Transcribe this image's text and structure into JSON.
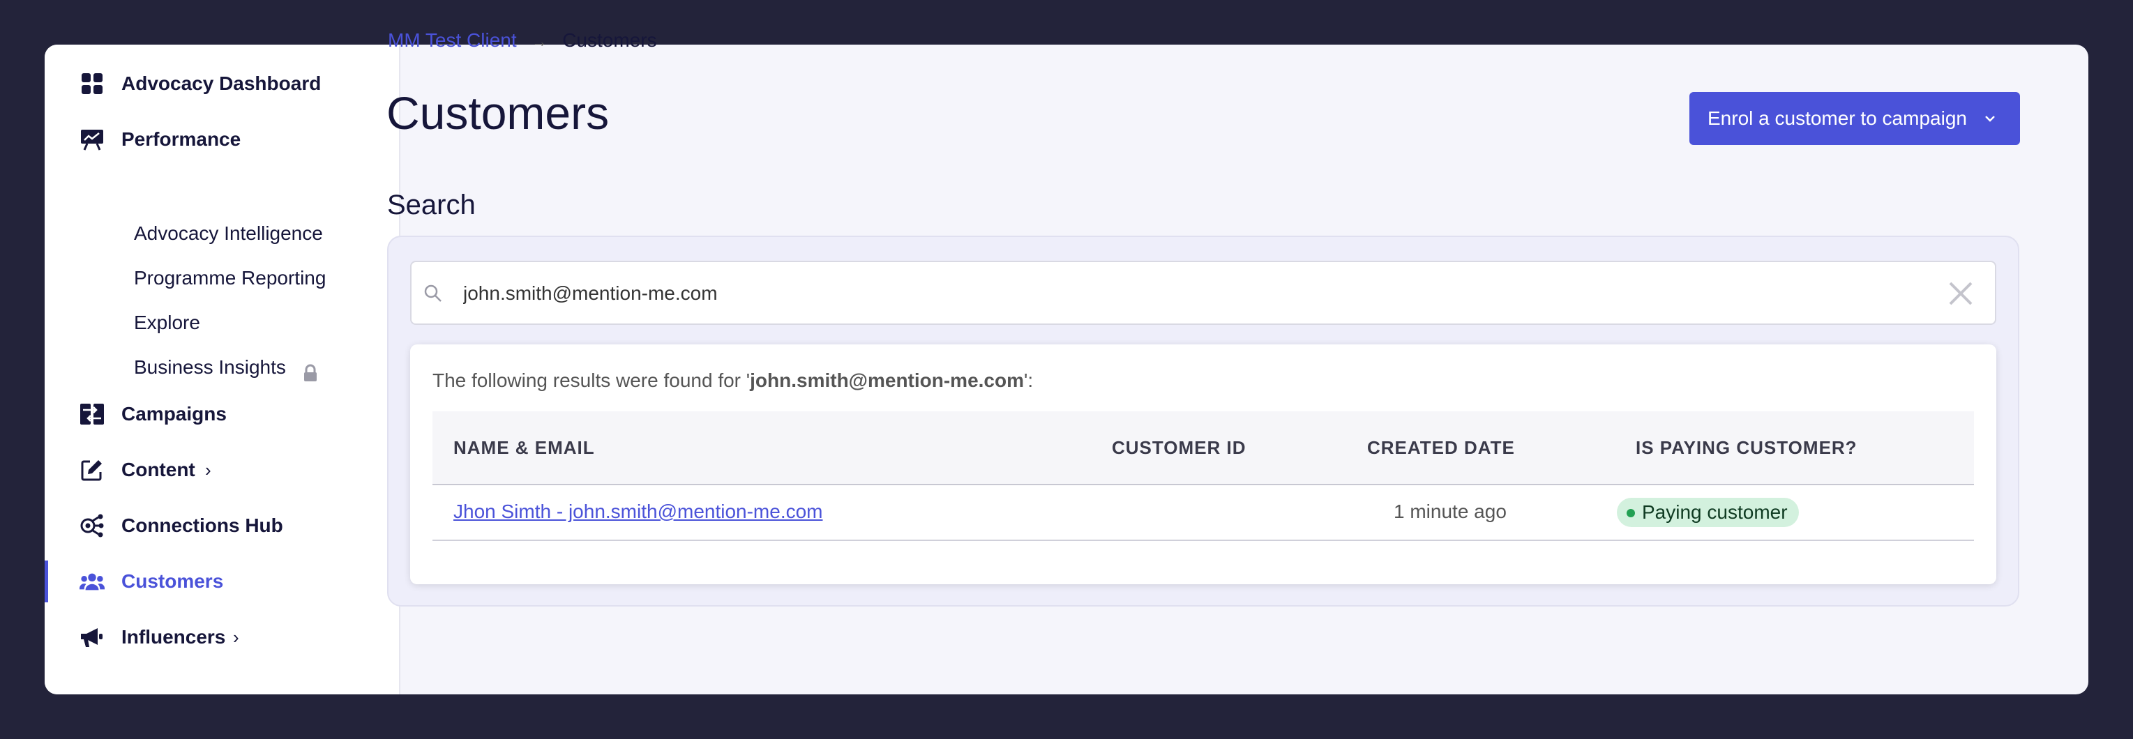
{
  "sidebar": {
    "items": [
      {
        "label": "Advocacy Dashboard",
        "icon": "grid-icon"
      },
      {
        "label": "Performance",
        "icon": "presentation-chart-icon"
      },
      {
        "label": "Campaigns",
        "icon": "exchange-icon"
      },
      {
        "label": "Content",
        "icon": "edit-icon"
      },
      {
        "label": "Connections Hub",
        "icon": "hub-icon"
      },
      {
        "label": "Customers",
        "icon": "users-icon",
        "active": true
      },
      {
        "label": "Influencers",
        "icon": "megaphone-icon"
      }
    ],
    "performance_sub": [
      {
        "label": "Advocacy Intelligence"
      },
      {
        "label": "Programme Reporting"
      },
      {
        "label": "Explore"
      },
      {
        "label": "Business Insights",
        "icon": "lock-icon"
      }
    ]
  },
  "breadcrumb": {
    "parent": "MM Test Client",
    "separator": "→",
    "current": "Customers"
  },
  "page": {
    "title": "Customers",
    "enrol_button": "Enrol a customer to campaign",
    "search_title": "Search"
  },
  "search": {
    "value": "john.smith@mention-me.com",
    "results_prefix": "The following results were found for '",
    "results_query": "john.smith@mention-me.com",
    "results_suffix": "':"
  },
  "table": {
    "headers": [
      "NAME & EMAIL",
      "CUSTOMER ID",
      "CREATED DATE",
      "IS PAYING CUSTOMER?"
    ],
    "rows": [
      {
        "name_email": "Jhon Simth - john.smith@mention-me.com",
        "customer_id": "",
        "created_date": "1 minute ago",
        "paying": "Paying customer"
      }
    ]
  },
  "colors": {
    "accent": "#4a52d9",
    "background": "#23233a",
    "badge_bg": "#d3f1de",
    "badge_dot": "#22a053"
  }
}
